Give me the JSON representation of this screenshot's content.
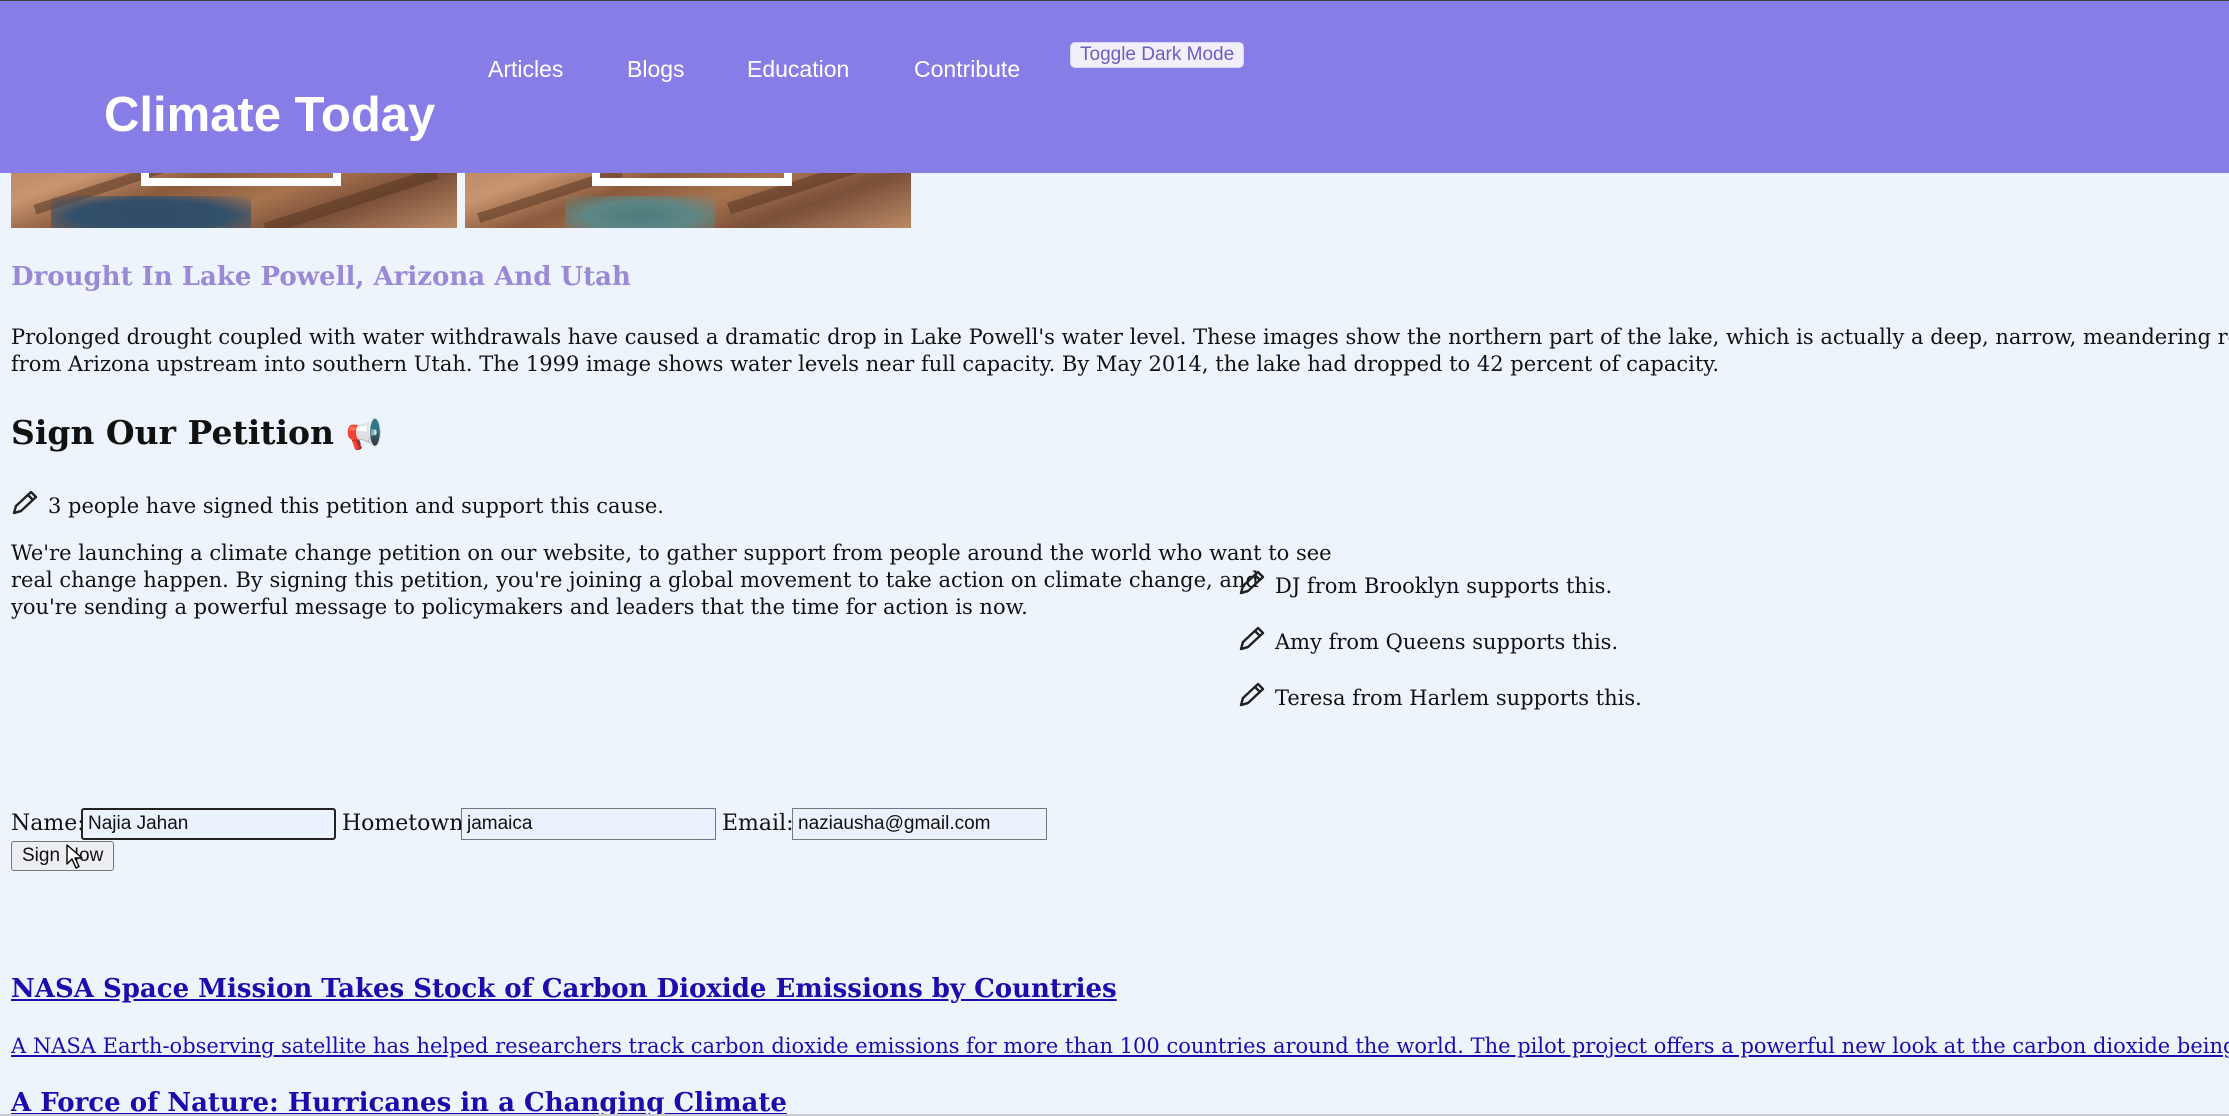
{
  "header": {
    "site_title": "Climate Today",
    "nav": [
      "Articles",
      "Blogs",
      "Education",
      "Contribute"
    ],
    "toggle_label": "Toggle Dark Mode"
  },
  "article": {
    "heading": "Drought In Lake Powell, Arizona And Utah",
    "body_line1": "Prolonged drought coupled with water withdrawals have caused a dramatic drop in Lake Powell's water level. These images show the northern part of the lake, which is actually a deep, narrow, meandering reservoir that extends",
    "body_line2": "from Arizona upstream into southern Utah. The 1999 image shows water levels near full capacity. By May 2014, the lake had dropped to 42 percent of capacity."
  },
  "petition": {
    "title": "Sign Our Petition",
    "megaphone": "📢",
    "icon": "pencil-icon",
    "count_text": "3 people have signed this petition and support this cause.",
    "description_line1": "We're launching a climate change petition on our website, to gather support from people around the world who want to see",
    "description_line2": "real change happen. By signing this petition, you're joining a global movement to take action on climate change, and",
    "description_line3": "you're sending a powerful message to policymakers and leaders that the time for action is now.",
    "supporters": [
      "DJ from Brooklyn supports this.",
      "Amy from Queens supports this.",
      "Teresa from Harlem supports this."
    ],
    "form": {
      "name_label": "Name:",
      "name_value": "Najia Jahan",
      "hometown_label": "Hometown:",
      "hometown_value": "jamaica",
      "email_label": "Email:",
      "email_value": "naziausha@gmail.com",
      "submit_label": "Sign Now"
    }
  },
  "news": [
    {
      "title": "NASA Space Mission Takes Stock of Carbon Dioxide Emissions by Countries",
      "summary": "A NASA Earth-observing satellite has helped researchers track carbon dioxide emissions for more than 100 countries around the world. The pilot project offers a powerful new look at the carbon dioxide being emitted...."
    },
    {
      "title": "A Force of Nature: Hurricanes in a Changing Climate"
    }
  ],
  "colors": {
    "header_bg": "#877de6",
    "page_bg": "#eef4fc",
    "article_heading": "#9a8ad6",
    "link": "#1a0dab"
  }
}
